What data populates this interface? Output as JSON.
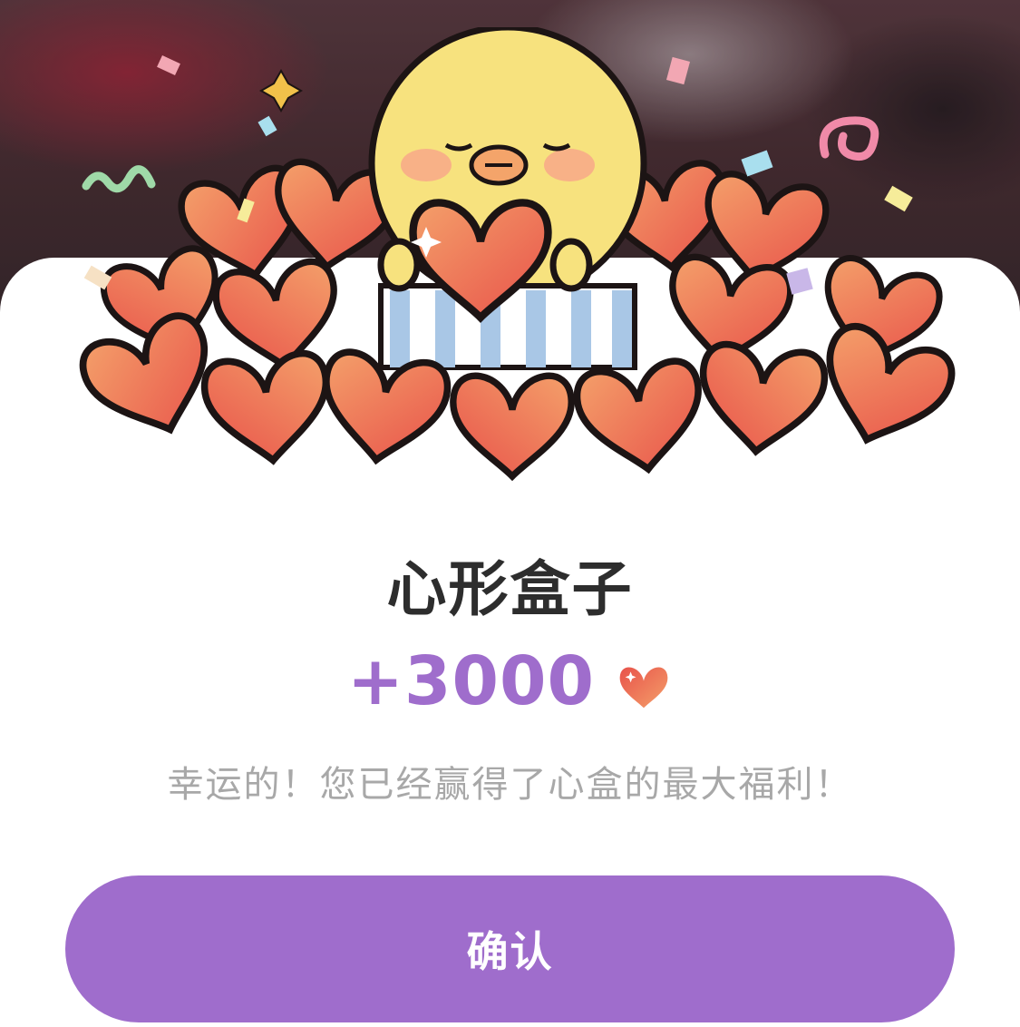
{
  "modal": {
    "title": "心形盒子",
    "reward_amount": "+3000",
    "reward_icon": "heart-icon",
    "message": "幸运的！您已经赢得了心盒的最大福利！",
    "confirm_label": "确认"
  },
  "colors": {
    "accent": "#9f6dcc",
    "title_text": "#2d2d2d",
    "message_text": "#a8a8a8",
    "heart_light": "#f4a06a",
    "heart_dark": "#e8524a",
    "chick": "#f7e27e"
  }
}
